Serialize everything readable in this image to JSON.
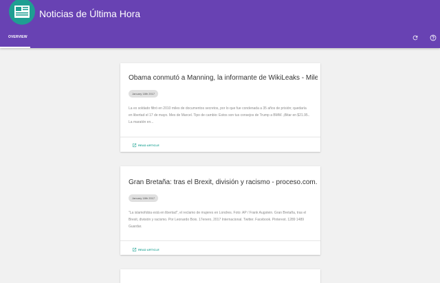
{
  "app": {
    "title": "Noticias de Última Hora"
  },
  "tabs": [
    {
      "label": "OVERVIEW",
      "active": true
    }
  ],
  "actions": {
    "refresh_icon": "refresh-icon",
    "help_icon": "help-icon"
  },
  "colors": {
    "appbar": "#6842b3",
    "logo": "#1f9e92",
    "accent": "#2aa89a",
    "background": "#f1f1f1"
  },
  "articles": [
    {
      "title": "Obama conmutó a Manning, la informante de WikiLeaks - Milenio.com",
      "date": "January 18th 2017",
      "summary": "La ex soldado filtró en 2010 miles de documentos secretos, por lo que fue condenada a 35 años de prisión; quedaría en libertad el 17 de mayo. Mes de Marcel. Tipo de cambio: Estos son tus consejos de Trump a BMW. ¡Bitar en $21.95.. La maratón en...",
      "read_label": "READ ARTICLE"
    },
    {
      "title": "Gran Bretaña: tras el Brexit, división y racismo - proceso.com.mx",
      "date": "January 18th 2017",
      "summary": "\"La islamofobia está en libertad\", el reclamo de mujeres en Londres. Foto: AP / Frank Augstein. Gran Bretaña, tras el Brexit, división y racismo. Por Leonardo Boix. 17enero, 2017 Internacional. Twitter. Facebook. Pinterest. 1289 1489 Guardar.",
      "read_label": "READ ARTICLE"
    }
  ]
}
